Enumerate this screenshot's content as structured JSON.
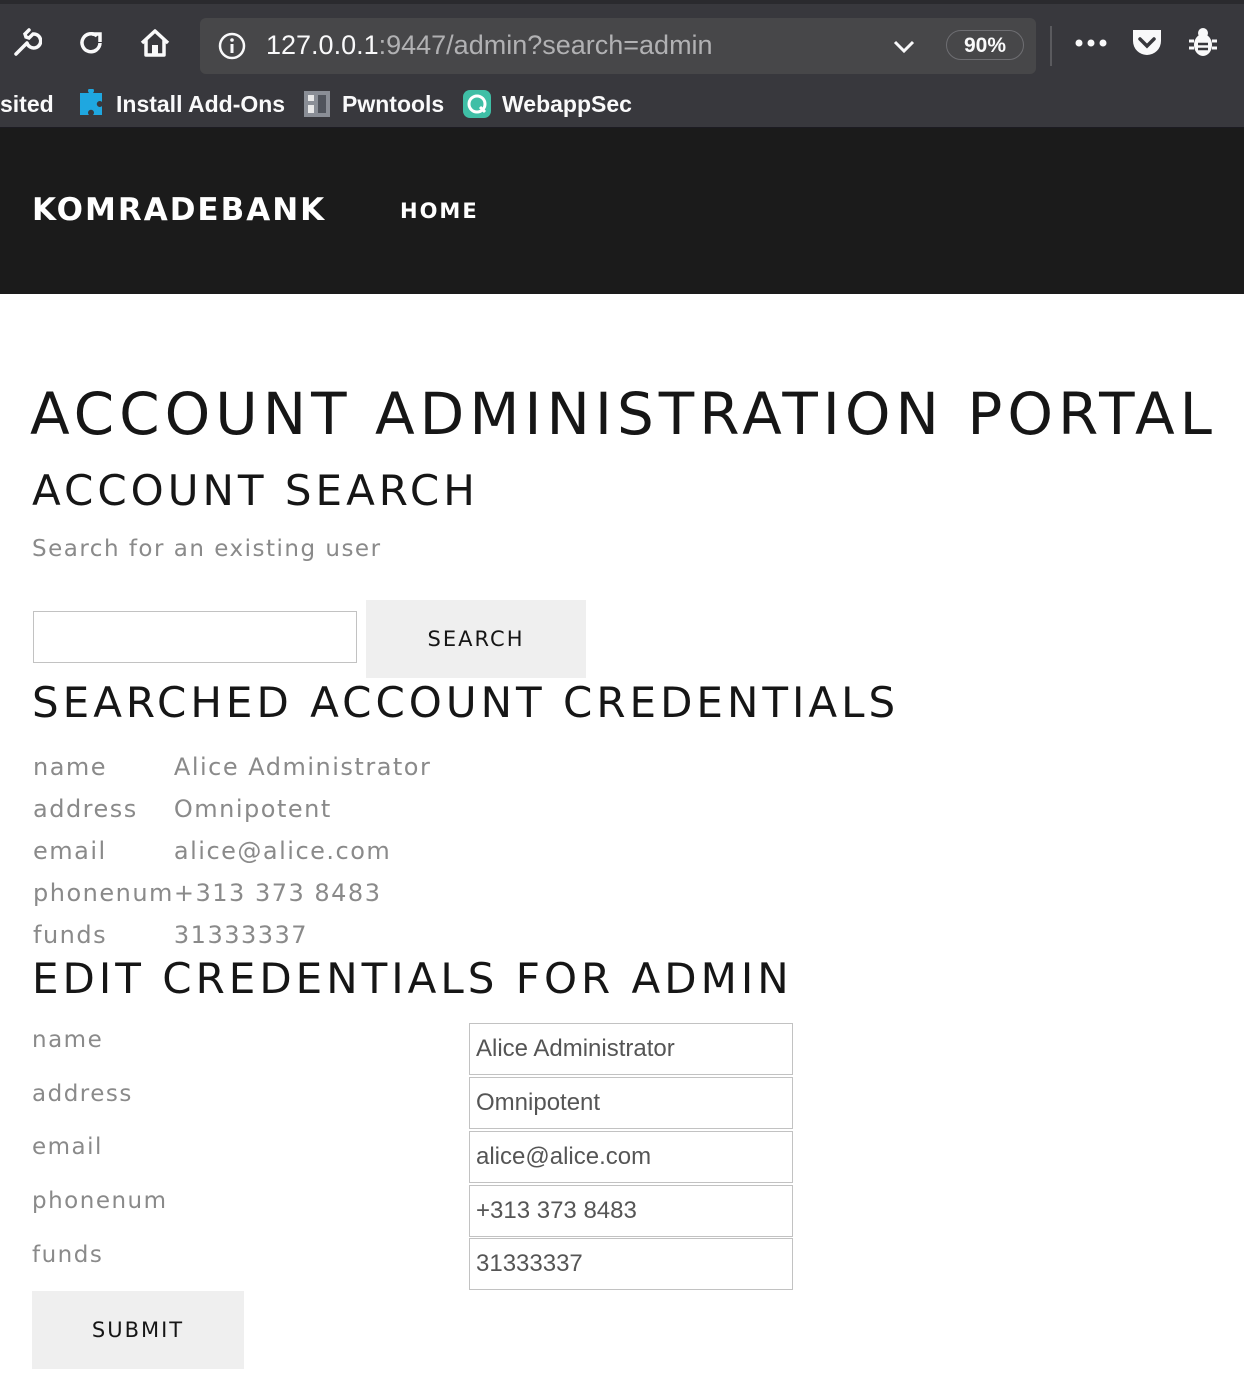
{
  "browser": {
    "url_host": "127.0.0.1",
    "url_rest": ":9447/admin?search=admin",
    "zoom": "90%",
    "bookmarks": [
      {
        "label": "sited",
        "icon": "none"
      },
      {
        "label": "Install Add-Ons",
        "icon": "puzzle-icon"
      },
      {
        "label": "Pwntools",
        "icon": "pwntools-icon"
      },
      {
        "label": "WebappSec",
        "icon": "webappsec-icon"
      }
    ]
  },
  "nav": {
    "brand": "KOMRADEBANK",
    "home": "HOME"
  },
  "page": {
    "title": "ACCOUNT ADMINISTRATION PORTAL",
    "search_heading": "ACCOUNT SEARCH",
    "search_subtitle": "Search for an existing user",
    "search_value": "",
    "search_button": "SEARCH",
    "creds_heading": "SEARCHED ACCOUNT CREDENTIALS",
    "creds": [
      {
        "key": "name",
        "value": "Alice Administrator"
      },
      {
        "key": "address",
        "value": "Omnipotent"
      },
      {
        "key": "email",
        "value": "alice@alice.com"
      },
      {
        "key": "phonenum",
        "value": "+313 373 8483"
      },
      {
        "key": "funds",
        "value": "31333337"
      }
    ],
    "edit_heading": "EDIT CREDENTIALS FOR ADMIN",
    "edit_fields": [
      {
        "label": "name",
        "value": "Alice Administrator"
      },
      {
        "label": "address",
        "value": "Omnipotent"
      },
      {
        "label": "email",
        "value": "alice@alice.com"
      },
      {
        "label": "phonenum",
        "value": "+313 373 8483"
      },
      {
        "label": "funds",
        "value": "31333337"
      }
    ],
    "submit_button": "SUBMIT"
  }
}
